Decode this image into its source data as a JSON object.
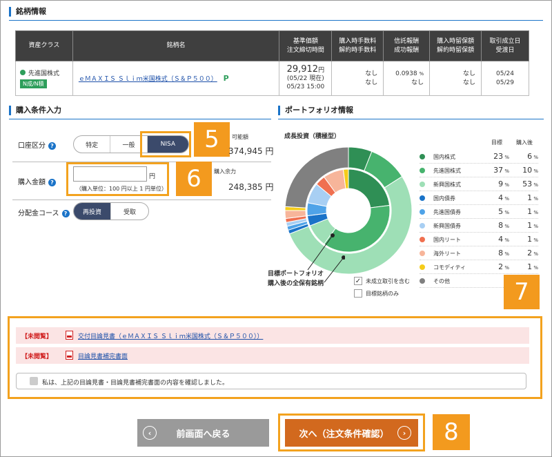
{
  "section1": {
    "title": "銘柄情報"
  },
  "table": {
    "headers": {
      "asset_class": "資産クラス",
      "fund_name": "銘柄名",
      "nav": [
        "基準価額",
        "注文締切時間"
      ],
      "buy_fee": [
        "購入時手数料",
        "解約時手数料"
      ],
      "trust_fee": [
        "信託報酬",
        "成功報酬"
      ],
      "reserve": [
        "購入時留保額",
        "解約時留保額"
      ],
      "dates": [
        "取引成立日",
        "受渡日"
      ]
    },
    "row": {
      "asset_class": "先進国株式",
      "badge": "N成/N積",
      "fund_name": "ｅＭＡＸＩＳ Ｓｌｉｍ米国株式（Ｓ＆Ｐ５００）",
      "point_icon": "P",
      "nav_value": "29,912",
      "nav_unit": "円",
      "nav_date": "(05/22 現在)",
      "cutoff": "05/23 15:00",
      "buy_fee": "なし",
      "sell_fee": "なし",
      "trust_fee": "0.0938",
      "trust_unit": "%",
      "success_fee": "なし",
      "buy_reserve": "なし",
      "sell_reserve": "なし",
      "trade_date": "05/24",
      "settle_date": "05/29"
    }
  },
  "section2": {
    "title": "購入条件入力"
  },
  "account": {
    "label": "口座区分",
    "options": [
      "特定",
      "一般",
      "NISA"
    ],
    "selected": "NISA",
    "avail_label": "可能額",
    "avail_value": "374,945 円"
  },
  "amount": {
    "label": "購入金額",
    "value": "",
    "unit": "円",
    "note": "（購入単位：100 円以上 1 円単位）",
    "remain_label": "購入余力",
    "remain_value": "248,385 円"
  },
  "dist": {
    "label": "分配金コース",
    "options": [
      "再投資",
      "受取"
    ],
    "selected": "再投資"
  },
  "section3": {
    "title": "ポートフォリオ情報"
  },
  "portfolio": {
    "strategy": "成長投資（積極型）",
    "col_target": "目標",
    "col_after": "購入後",
    "annotation_line1": "目標ポートフォリオ",
    "annotation_line2": "購入後の全保有銘柄",
    "check_pending": "未成立取引を含む",
    "check_pending_checked": true,
    "check_target_only": "目標銘柄のみ",
    "check_target_only_checked": false
  },
  "chart_data": {
    "type": "pie",
    "title": "成長投資（積極型）",
    "categories": [
      "国内株式",
      "先進国株式",
      "新興国株式",
      "国内債券",
      "先進国債券",
      "新興国債券",
      "国内リート",
      "海外リート",
      "コモディティ",
      "その他"
    ],
    "colors": [
      "#2f8f55",
      "#47b36e",
      "#9edfb6",
      "#1a73c8",
      "#4fa3e8",
      "#a8cff3",
      "#f07050",
      "#f7b59a",
      "#f5cc1a",
      "#808080"
    ],
    "series": [
      {
        "name": "目標",
        "values": [
          23,
          37,
          9,
          4,
          5,
          8,
          4,
          8,
          2,
          0
        ],
        "display": [
          "23",
          "37",
          "9",
          "4",
          "5",
          "8",
          "4",
          "8",
          "2",
          "-"
        ]
      },
      {
        "name": "購入後",
        "values": [
          6,
          10,
          53,
          1,
          1,
          1,
          1,
          2,
          1,
          24
        ],
        "display": [
          "6",
          "10",
          "53",
          "1",
          "1",
          "1",
          "1",
          "2",
          "1",
          ""
        ]
      }
    ],
    "unit": "%"
  },
  "docs": {
    "rows": [
      {
        "tag": "【未閲覧】",
        "link": "交付目論見書（ｅＭＡＸＩＳ Ｓｌｉｍ米国株式（Ｓ＆Ｐ５００））"
      },
      {
        "tag": "【未閲覧】",
        "link": "目論見書補完書面"
      }
    ],
    "confirm": "私は、上記の目論見書・目論見書補完書面の内容を確認しました。"
  },
  "buttons": {
    "back": "前画面へ戻る",
    "next": "次へ（注文条件確認）"
  },
  "callouts": [
    "5",
    "6",
    "7",
    "8"
  ],
  "colors": {
    "accent": "#1a73c8",
    "callout": "#f39a1e",
    "next_button": "#d2691e",
    "back_button": "#9a9a9a",
    "selected": "#3b4a6b"
  }
}
